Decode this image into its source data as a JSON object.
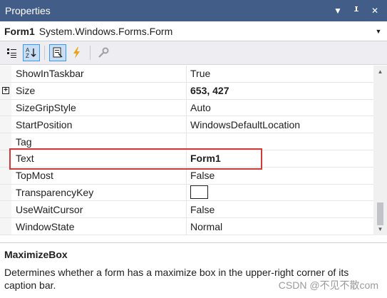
{
  "panel": {
    "title": "Properties"
  },
  "object_selector": {
    "name": "Form1",
    "type": "System.Windows.Forms.Form"
  },
  "toolbar": {
    "buttons": [
      "categorized-icon",
      "alphabetical-icon",
      "properties-icon",
      "events-icon",
      "property-pages-icon"
    ]
  },
  "properties": [
    {
      "name": "ShowInTaskbar",
      "value": "True",
      "bold": false
    },
    {
      "name": "Size",
      "value": "653, 427",
      "bold": true,
      "expandable": true
    },
    {
      "name": "SizeGripStyle",
      "value": "Auto",
      "bold": false
    },
    {
      "name": "StartPosition",
      "value": "WindowsDefaultLocation",
      "bold": false
    },
    {
      "name": "Tag",
      "value": "",
      "bold": false
    },
    {
      "name": "Text",
      "value": "Form1",
      "bold": true
    },
    {
      "name": "TopMost",
      "value": "False",
      "bold": false
    },
    {
      "name": "TransparencyKey",
      "value": "",
      "bold": false
    },
    {
      "name": "UseWaitCursor",
      "value": "False",
      "bold": false
    },
    {
      "name": "WindowState",
      "value": "Normal",
      "bold": false
    }
  ],
  "description": {
    "title": "MaximizeBox",
    "text": "Determines whether a form has a maximize box in the upper-right corner of its caption bar."
  },
  "watermark": "CSDN @不见不散com",
  "colors": {
    "titlebar": "#425d87",
    "highlight_border": "#d23a3a"
  }
}
